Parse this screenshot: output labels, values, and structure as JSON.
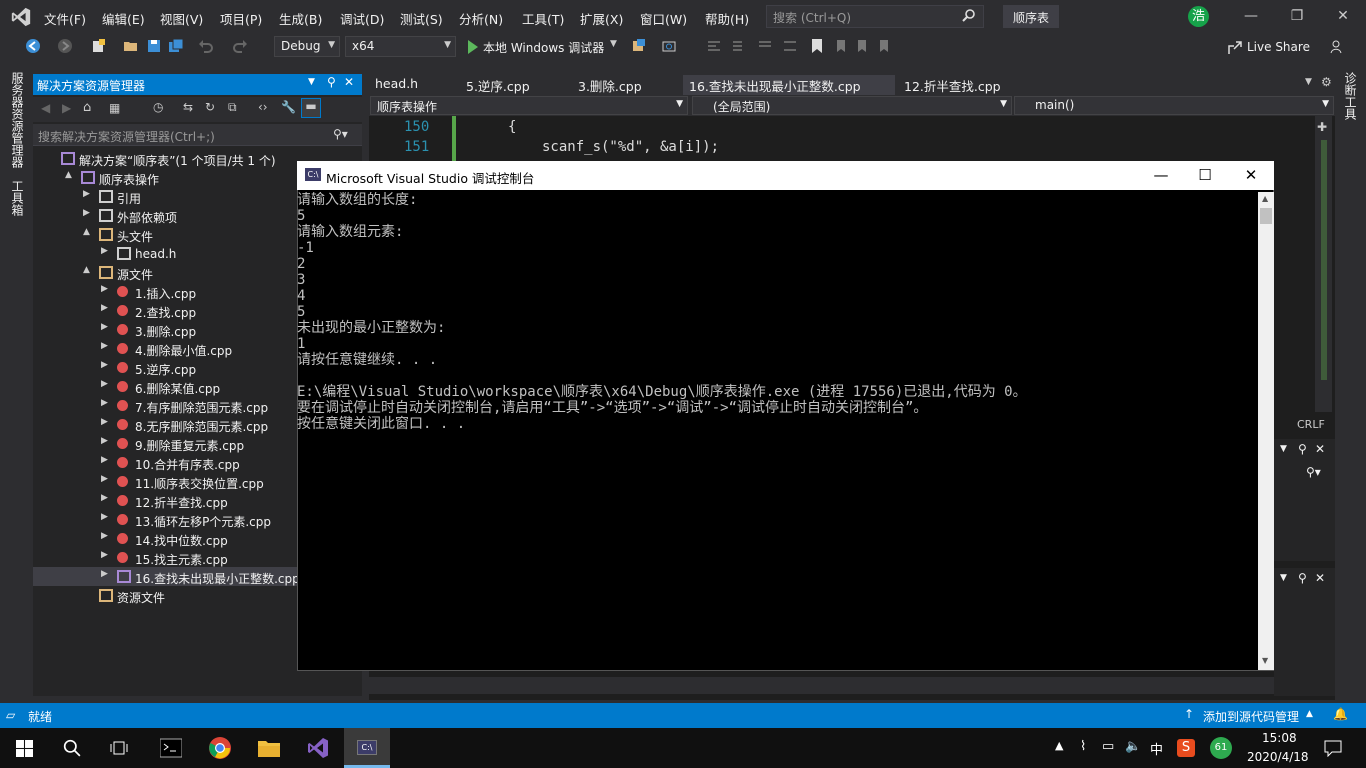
{
  "menubar": {
    "items": [
      "文件(F)",
      "编辑(E)",
      "视图(V)",
      "项目(P)",
      "生成(B)",
      "调试(D)",
      "测试(S)",
      "分析(N)",
      "工具(T)",
      "扩展(X)",
      "窗口(W)",
      "帮助(H)"
    ],
    "search_placeholder": "搜索 (Ctrl+Q)",
    "solution_title": "顺序表",
    "user_initial": "浩"
  },
  "toolbar": {
    "config": "Debug",
    "platform": "x64",
    "run_label": "本地 Windows 调试器",
    "liveshare": "Live Share"
  },
  "left_strip": {
    "server_explorer": "服务器资源管理器",
    "toolbox": "工具箱"
  },
  "right_strip": {
    "diagnostics": "诊断工具"
  },
  "solution_explorer": {
    "title": "解决方案资源管理器",
    "search_placeholder": "搜索解决方案资源管理器(Ctrl+;)",
    "tree": [
      {
        "label": "解决方案“顺序表”(1 个项目/共 1 个)",
        "level": 0,
        "icon": "solution",
        "exp": ""
      },
      {
        "label": "顺序表操作",
        "level": 1,
        "icon": "project",
        "exp": "▲"
      },
      {
        "label": "引用",
        "level": 2,
        "icon": "references",
        "exp": "▶"
      },
      {
        "label": "外部依赖项",
        "level": 2,
        "icon": "external",
        "exp": "▶"
      },
      {
        "label": "头文件",
        "level": 2,
        "icon": "folder",
        "exp": "▲"
      },
      {
        "label": "head.h",
        "level": 3,
        "icon": "header",
        "exp": "▶"
      },
      {
        "label": "源文件",
        "level": 2,
        "icon": "folder",
        "exp": "▲"
      },
      {
        "label": "1.插入.cpp",
        "level": 3,
        "icon": "cpp-excluded",
        "exp": "▶"
      },
      {
        "label": "2.查找.cpp",
        "level": 3,
        "icon": "cpp-excluded",
        "exp": "▶"
      },
      {
        "label": "3.删除.cpp",
        "level": 3,
        "icon": "cpp-excluded",
        "exp": "▶"
      },
      {
        "label": "4.删除最小值.cpp",
        "level": 3,
        "icon": "cpp-excluded",
        "exp": "▶"
      },
      {
        "label": "5.逆序.cpp",
        "level": 3,
        "icon": "cpp-excluded",
        "exp": "▶"
      },
      {
        "label": "6.删除某值.cpp",
        "level": 3,
        "icon": "cpp-excluded",
        "exp": "▶"
      },
      {
        "label": "7.有序删除范围元素.cpp",
        "level": 3,
        "icon": "cpp-excluded",
        "exp": "▶"
      },
      {
        "label": "8.无序删除范围元素.cpp",
        "level": 3,
        "icon": "cpp-excluded",
        "exp": "▶"
      },
      {
        "label": "9.删除重复元素.cpp",
        "level": 3,
        "icon": "cpp-excluded",
        "exp": "▶"
      },
      {
        "label": "10.合并有序表.cpp",
        "level": 3,
        "icon": "cpp-excluded",
        "exp": "▶"
      },
      {
        "label": "11.顺序表交换位置.cpp",
        "level": 3,
        "icon": "cpp-excluded",
        "exp": "▶"
      },
      {
        "label": "12.折半查找.cpp",
        "level": 3,
        "icon": "cpp-excluded",
        "exp": "▶"
      },
      {
        "label": "13.循环左移P个元素.cpp",
        "level": 3,
        "icon": "cpp-excluded",
        "exp": "▶"
      },
      {
        "label": "14.找中位数.cpp",
        "level": 3,
        "icon": "cpp-excluded",
        "exp": "▶"
      },
      {
        "label": "15.找主元素.cpp",
        "level": 3,
        "icon": "cpp-excluded",
        "exp": "▶"
      },
      {
        "label": "16.查找未出现最小正整数.cpp",
        "level": 3,
        "icon": "cpp",
        "exp": "▶",
        "selected": true
      },
      {
        "label": "资源文件",
        "level": 2,
        "icon": "folder",
        "exp": ""
      }
    ]
  },
  "editor": {
    "tabs": [
      "head.h",
      "5.逆序.cpp",
      "3.删除.cpp",
      "16.查找未出现最小正整数.cpp",
      "12.折半查找.cpp"
    ],
    "nav_project": "顺序表操作",
    "nav_scope": "(全局范围)",
    "nav_member": "main()",
    "lines": [
      {
        "num": "150",
        "code": "{"
      },
      {
        "num": "151",
        "code": "scanf_s(\"%d\", &a[i]);"
      }
    ],
    "crlf": "CRLF"
  },
  "console": {
    "title": "Microsoft Visual Studio 调试控制台",
    "icon_text": "C:\\",
    "lines": [
      "请输入数组的长度:",
      "5",
      "请输入数组元素:",
      "-1",
      "2",
      "3",
      "4",
      "5",
      "未出现的最小正整数为:",
      "1",
      "请按任意键继续. . .",
      "",
      "E:\\编程\\Visual Studio\\workspace\\顺序表\\x64\\Debug\\顺序表操作.exe (进程 17556)已退出,代码为 0。",
      "要在调试停止时自动关闭控制台,请启用“工具”->“选项”->“调试”->“调试停止时自动关闭控制台”。",
      "按任意键关闭此窗口. . ."
    ]
  },
  "statusbar": {
    "ready": "就绪",
    "source_control": "添加到源代码管理"
  },
  "taskbar": {
    "time": "15:08",
    "date": "2020/4/18",
    "ime": "中",
    "badge": "61"
  }
}
